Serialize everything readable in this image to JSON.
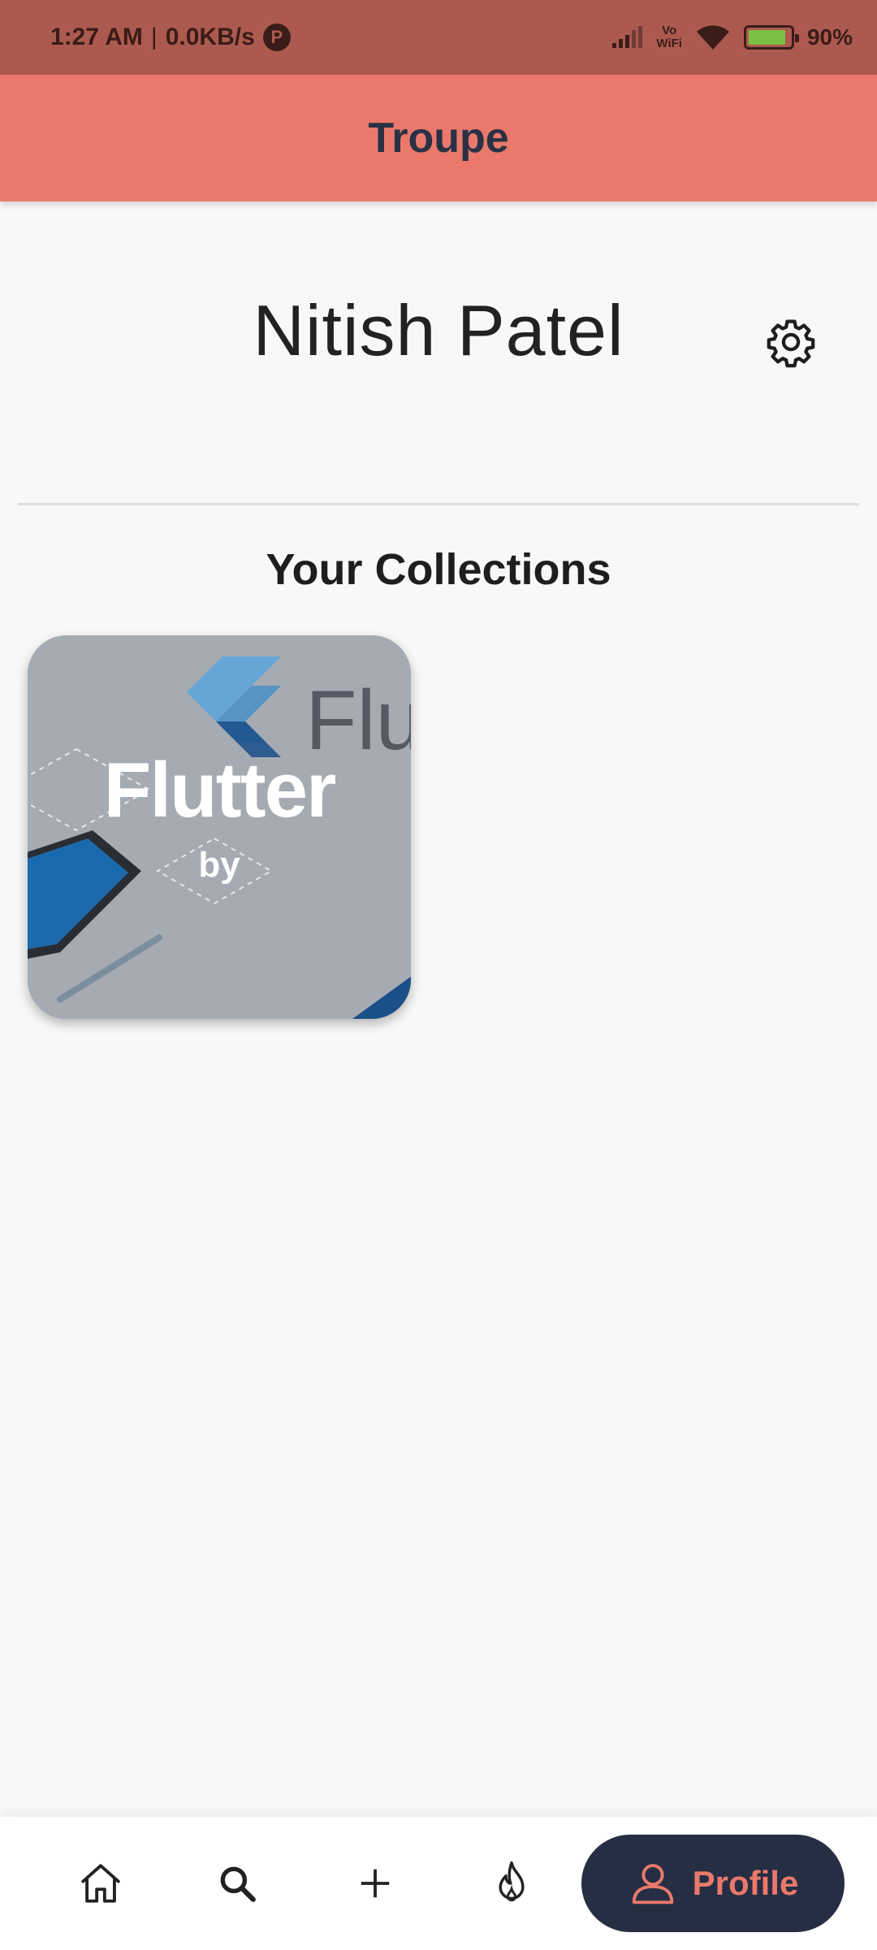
{
  "status_bar": {
    "time": "1:27 AM",
    "separator": "|",
    "net_speed": "0.0KB/s",
    "vowifi_top": "Vo",
    "vowifi_bottom": "WiFi",
    "battery_percent": "90%",
    "battery_level": 0.9,
    "icons": [
      "app-notification-icon",
      "signal-icon",
      "vowifi-icon",
      "wifi-icon",
      "battery-charging-icon"
    ]
  },
  "app_bar": {
    "title": "Troupe"
  },
  "profile": {
    "name": "Nitish Patel",
    "settings_icon": "gear-icon"
  },
  "collections": {
    "heading": "Your Collections",
    "items": [
      {
        "title": "Flutter",
        "subtitle": "by",
        "background_text": "Flu"
      }
    ]
  },
  "bottom_nav": {
    "items": [
      {
        "icon": "home-icon"
      },
      {
        "icon": "search-icon"
      },
      {
        "icon": "plus-icon"
      },
      {
        "icon": "flame-icon"
      },
      {
        "icon": "profile-icon",
        "label": "Profile",
        "active": true
      }
    ]
  },
  "colors": {
    "status_bar": "#ac5a4f",
    "app_bar": "#ea796c",
    "title_text": "#2a3145",
    "nav_active_bg": "#262e43",
    "nav_active_text": "#ea796c",
    "background": "#f8f8f8"
  }
}
